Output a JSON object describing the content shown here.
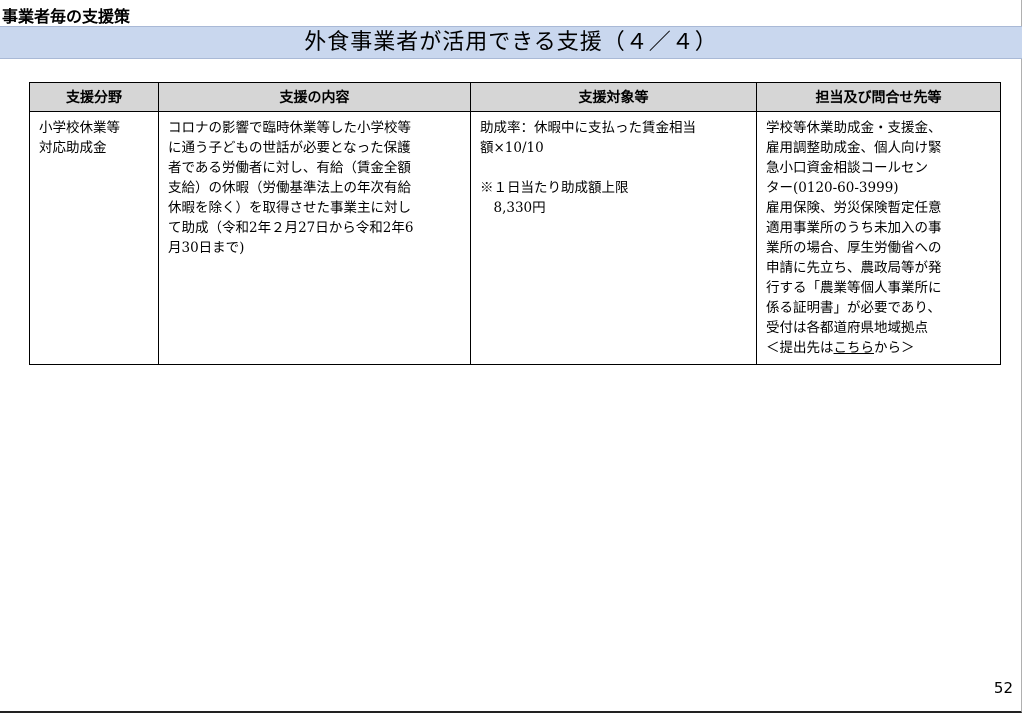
{
  "section_label": "事業者毎の支援策",
  "title": "外食事業者が活用できる支援（４／４）",
  "table": {
    "headers": [
      "支援分野",
      "支援の内容",
      "支援対象等",
      "担当及び問合せ先等"
    ],
    "row": {
      "field": "小学校休業等\n対応助成金",
      "content": "コロナの影響で臨時休業等した小学校等\nに通う子どもの世話が必要となった保護\n者である労働者に対し、有給（賃金全額\n支給）の休暇（労働基準法上の年次有給\n休暇を除く）を取得させた事業主に対し\nて助成（令和2年２月27日から令和2年6\n月30日まで)",
      "target": "助成率：休暇中に支払った賃金相当\n額×10/10\n\n※１日当たり助成額上限\n　8,330円",
      "contact_main": "学校等休業助成金・支援金、\n雇用調整助成金、個人向け緊\n急小口資金相談コールセン\nター(0120-60-3999)\n雇用保険、労災保険暫定任意\n適用事業所のうち未加入の事\n業所の場合、厚生労働省への\n申請に先立ち、農政局等が発\n行する「農業等個人事業所に\n係る証明書」が必要であり、\n受付は各都道府県地域拠点\n",
      "contact_link_prefix": "＜提出先は",
      "contact_link_text": "こちら",
      "contact_link_suffix": "から＞"
    }
  },
  "page_number": "52"
}
